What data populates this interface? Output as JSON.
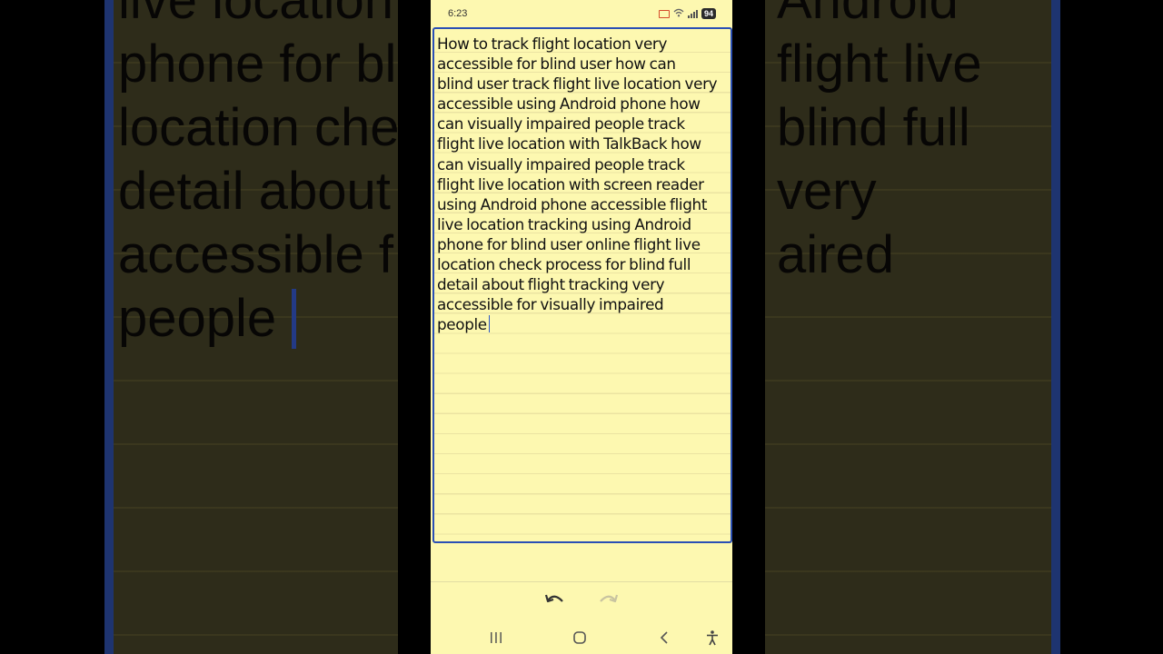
{
  "status_bar": {
    "time": "6:23",
    "battery": "94",
    "icons": [
      "cast-icon",
      "wifi-icon",
      "signal-icon",
      "battery-icon"
    ]
  },
  "note": {
    "lines": [
      "How to track flight location very",
      "accessible for blind user how can",
      "blind user track flight live location very",
      "accessible using Android phone how",
      "can visually impaired people track",
      "flight live location with TalkBack how",
      "can visually impaired people track",
      "flight live location with screen reader",
      "using Android phone accessible flight",
      "live location tracking using Android",
      "phone for blind user online flight live",
      "location check process for blind full",
      "detail about flight tracking very",
      "accessible for visually impaired",
      "people"
    ]
  },
  "background_magnified": {
    "text": "live location\nphone for bl\nlocation che\ndetail about\naccessible f\npeople",
    "text_right": "Android\nflight live\nblind full\nvery\naired"
  },
  "toolbar": {
    "icons": [
      "undo-icon",
      "redo-icon"
    ]
  },
  "nav_bar": {
    "icons": [
      "recents-icon",
      "home-icon",
      "back-icon",
      "accessibility-icon"
    ]
  },
  "colors": {
    "note_background": "#fdf8b0",
    "editor_border": "#2a4fb5",
    "cursor": "#2a56c8",
    "background_dim": "#2e2c1a"
  }
}
